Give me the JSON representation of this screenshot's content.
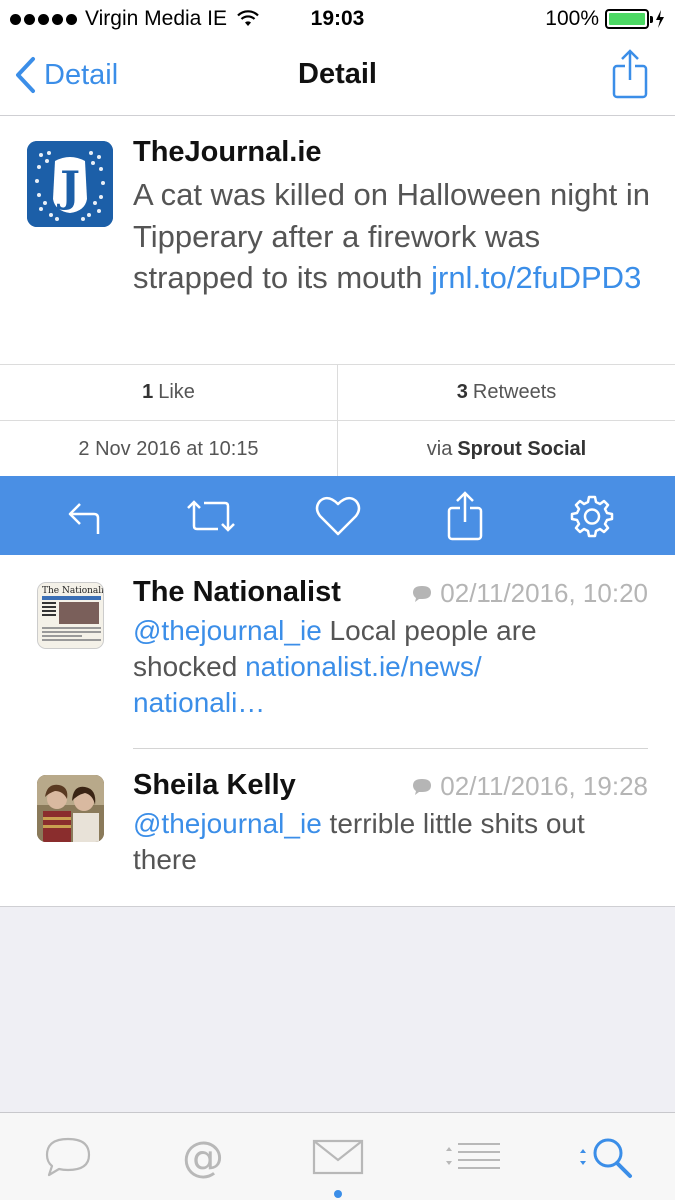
{
  "status_bar": {
    "carrier": "Virgin Media IE",
    "time": "19:03",
    "battery": "100%"
  },
  "nav": {
    "back_label": "Detail",
    "title": "Detail"
  },
  "tweet": {
    "author": "TheJournal.ie",
    "text": "A cat was killed on Halloween night in Tipperary after a firework was strapped to its mouth ",
    "link": "jrnl.to/2fuDPD3"
  },
  "stats": {
    "likes_count": "1",
    "likes_label": "Like",
    "retweets_count": "3",
    "retweets_label": "Retweets",
    "date": "2 Nov 2016 at 10:15",
    "via_prefix": "via",
    "via_source": "Sprout Social"
  },
  "actions": [
    "reply-icon",
    "retweet-icon",
    "heart-icon",
    "share-icon",
    "gear-icon"
  ],
  "replies": [
    {
      "name": "The Nationalist",
      "timestamp": "02/11/2016, 10:20",
      "mention": "@thejournal_ie",
      "text": " Local people are shocked ",
      "link": "nationalist.ie/news/\nnationali…"
    },
    {
      "name": "Sheila Kelly",
      "timestamp": "02/11/2016, 19:28",
      "mention": "@thejournal_ie",
      "text": " terrible little shits out there",
      "link": ""
    }
  ],
  "tabs": [
    "speech-bubble-icon",
    "at-sign-icon",
    "envelope-icon",
    "list-icon",
    "search-icon"
  ],
  "colors": {
    "accent": "#3b8ee8",
    "action_bar": "#4a8fe4",
    "battery": "#4cd964"
  }
}
